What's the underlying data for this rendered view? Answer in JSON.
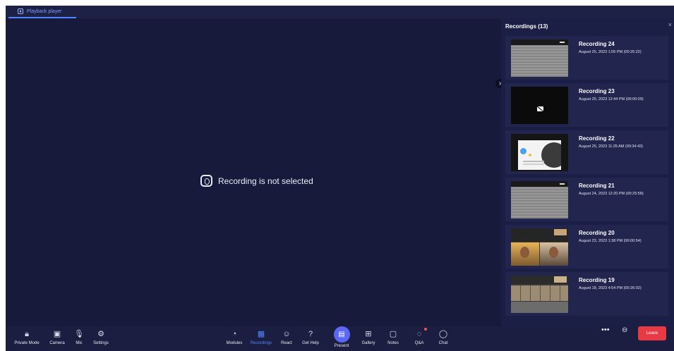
{
  "tab": {
    "label": "Playback player",
    "icon": "play-square-icon"
  },
  "stage": {
    "empty_message": "Recording is not selected",
    "icon": "recording-icon"
  },
  "panel": {
    "title": "Recordings (13)",
    "close_glyph": "×",
    "collapse_glyph": "›",
    "recordings": [
      {
        "title": "Recording 24",
        "meta": "August 25, 2023 1:05 PM (00:25:22)",
        "thumb": "grey"
      },
      {
        "title": "Recording 23",
        "meta": "August 25, 2023 12:44 PM (00:00:09)",
        "thumb": "black"
      },
      {
        "title": "Recording 22",
        "meta": "August 25, 2023 11:25 AM (00:34:43)",
        "thumb": "slide"
      },
      {
        "title": "Recording 21",
        "meta": "August 24, 2023 12:20 PM (00:25:58)",
        "thumb": "grey"
      },
      {
        "title": "Recording 20",
        "meta": "August 23, 2023 1:38 PM (00:00:54)",
        "thumb": "faces"
      },
      {
        "title": "Recording 19",
        "meta": "August 18, 2023 4:54 PM (00:26:02)",
        "thumb": "gallery"
      }
    ]
  },
  "toolbar": {
    "private_mode": "Private Mode",
    "camera": "Camera",
    "mic": "Mic",
    "settings": "Settings",
    "modules": "Modules",
    "recordings": "Recordings",
    "react": "React",
    "get_help": "Get Help",
    "present": "Present",
    "gallery": "Gallery",
    "notes": "Notes",
    "qa": "Q&A",
    "chat": "Chat",
    "more_glyph": "•••",
    "link_glyph": "⊖",
    "leave": "Leave"
  },
  "glyphs": {
    "private_mode": "🔒︎",
    "camera": "▣",
    "mic": "🎙︎",
    "settings": "⚙",
    "modules": "◔",
    "recordings": "▦",
    "react": "☺",
    "get_help": "?",
    "present": "▤",
    "gallery": "⊞",
    "notes": "▢",
    "qa": "◌",
    "chat": "◯"
  },
  "colors": {
    "accent": "#4f86ff",
    "leave": "#e83a45",
    "background": "#181a3c",
    "panel": "#1c1f45"
  }
}
